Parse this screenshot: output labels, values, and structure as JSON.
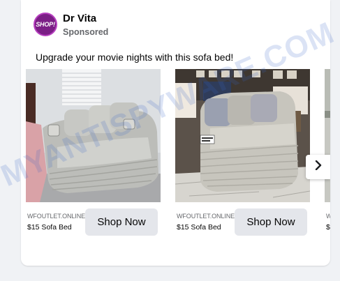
{
  "post": {
    "page_name": "Dr Vita",
    "sponsored_label": "Sponsored",
    "avatar_text": "SHOP!",
    "text": "Upgrade your movie nights with this sofa bed!"
  },
  "carousel": {
    "items": [
      {
        "domain": "WFOUTLET.ONLINE",
        "title": "$15 Sofa Bed",
        "button": "Shop Now"
      },
      {
        "domain": "WFOUTLET.ONLINE",
        "title": "$15 Sofa Bed",
        "button": "Shop Now"
      },
      {
        "domain": "W",
        "title": "$",
        "button": ""
      }
    ],
    "next_icon": "chevron-right-icon"
  },
  "watermark": {
    "text": "MYANTISPYWARE.COM"
  },
  "colors": {
    "avatar": "#7b1e86",
    "button_bg": "#e4e6eb",
    "secondary_text": "#65676b",
    "feed_bg": "#f0f2f5"
  }
}
